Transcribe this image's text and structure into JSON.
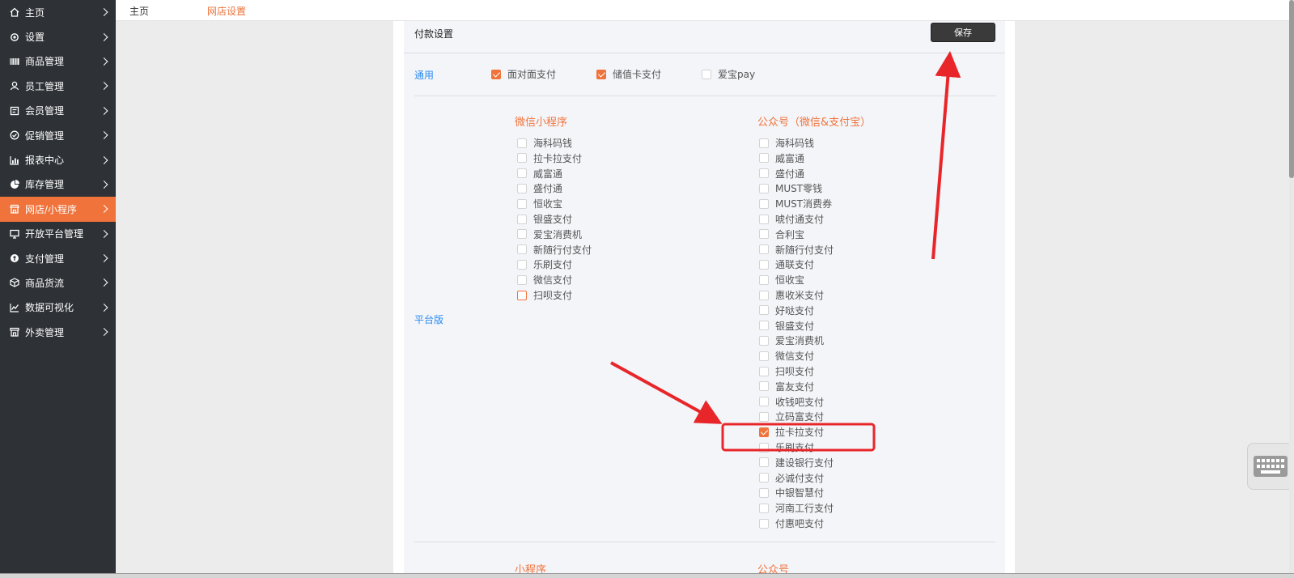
{
  "sidebar": {
    "items": [
      {
        "label": "主页",
        "icon": "home-icon"
      },
      {
        "label": "设置",
        "icon": "gear-icon"
      },
      {
        "label": "商品管理",
        "icon": "barcode-icon"
      },
      {
        "label": "员工管理",
        "icon": "user-icon"
      },
      {
        "label": "会员管理",
        "icon": "member-card-icon"
      },
      {
        "label": "促销管理",
        "icon": "check-circle-icon"
      },
      {
        "label": "报表中心",
        "icon": "bar-chart-icon"
      },
      {
        "label": "库存管理",
        "icon": "pie-chart-icon"
      },
      {
        "label": "网店/小程序",
        "icon": "store-icon"
      },
      {
        "label": "开放平台管理",
        "icon": "monitor-icon"
      },
      {
        "label": "支付管理",
        "icon": "coin-icon"
      },
      {
        "label": "商品货流",
        "icon": "box-icon"
      },
      {
        "label": "数据可视化",
        "icon": "line-chart-icon"
      },
      {
        "label": "外卖管理",
        "icon": "shop-icon"
      }
    ],
    "active_index": 8
  },
  "breadcrumb": {
    "home": "主页",
    "current": "网店设置"
  },
  "panel": {
    "title": "付款设置",
    "save_label": "保存"
  },
  "general": {
    "label": "通用",
    "options": [
      {
        "label": "面对面支付",
        "checked": true
      },
      {
        "label": "储值卡支付",
        "checked": true
      },
      {
        "label": "爱宝pay",
        "checked": false
      }
    ]
  },
  "platform": {
    "label": "平台版",
    "mini_program": {
      "title": "微信小程序",
      "items": [
        {
          "label": "海科码钱",
          "checked": false
        },
        {
          "label": "拉卡拉支付",
          "checked": false
        },
        {
          "label": "威富通",
          "checked": false
        },
        {
          "label": "盛付通",
          "checked": false
        },
        {
          "label": "恒收宝",
          "checked": false
        },
        {
          "label": "银盛支付",
          "checked": false
        },
        {
          "label": "爱宝消费机",
          "checked": false
        },
        {
          "label": "新随行付支付",
          "checked": false
        },
        {
          "label": "乐刷支付",
          "checked": false
        },
        {
          "label": "微信支付",
          "checked": false
        },
        {
          "label": "扫呗支付",
          "checked": false,
          "focused": true
        }
      ]
    },
    "official": {
      "title": "公众号（微信&支付宝）",
      "items": [
        {
          "label": "海科码钱",
          "checked": false
        },
        {
          "label": "威富通",
          "checked": false
        },
        {
          "label": "盛付通",
          "checked": false
        },
        {
          "label": "MUST零钱",
          "checked": false
        },
        {
          "label": "MUST消费券",
          "checked": false
        },
        {
          "label": "唬付通支付",
          "checked": false
        },
        {
          "label": "合利宝",
          "checked": false
        },
        {
          "label": "新随行付支付",
          "checked": false
        },
        {
          "label": "通联支付",
          "checked": false
        },
        {
          "label": "恒收宝",
          "checked": false
        },
        {
          "label": "惠收米支付",
          "checked": false
        },
        {
          "label": "好哒支付",
          "checked": false
        },
        {
          "label": "银盛支付",
          "checked": false
        },
        {
          "label": "爱宝消费机",
          "checked": false
        },
        {
          "label": "微信支付",
          "checked": false
        },
        {
          "label": "扫呗支付",
          "checked": false
        },
        {
          "label": "富友支付",
          "checked": false
        },
        {
          "label": "收钱吧支付",
          "checked": false
        },
        {
          "label": "立码富支付",
          "checked": false
        },
        {
          "label": "拉卡拉支付",
          "checked": true
        },
        {
          "label": "乐刷支付",
          "checked": false
        },
        {
          "label": "建设银行支付",
          "checked": false
        },
        {
          "label": "必诚付支付",
          "checked": false
        },
        {
          "label": "中银智慧付",
          "checked": false
        },
        {
          "label": "河南工行支付",
          "checked": false
        },
        {
          "label": "付惠吧支付",
          "checked": false
        }
      ]
    }
  },
  "next_section": {
    "left_title": "小程序",
    "right_title": "公众号"
  },
  "colors": {
    "accent": "#f0733b",
    "link": "#2d8cf0",
    "sidebar_bg": "#2e3136",
    "annotation": "#e8262a"
  }
}
